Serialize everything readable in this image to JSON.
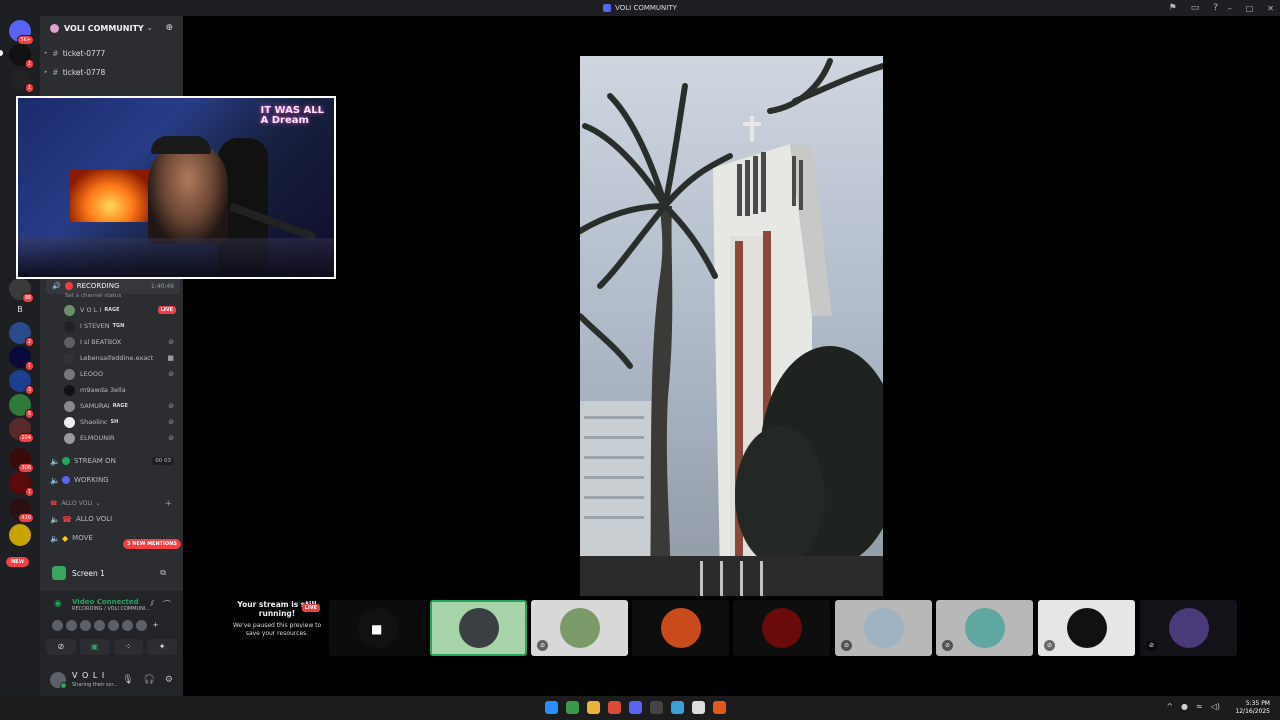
{
  "window": {
    "title": "VOLI COMMUNITY",
    "controls": [
      "–",
      "□",
      "✕"
    ]
  },
  "server": {
    "name": "VOLI COMMUNITY"
  },
  "rail_badges": [
    "5K+",
    "1",
    "1",
    "98",
    "2",
    "1",
    "3",
    "5",
    "6",
    "204",
    "306",
    "1",
    "430",
    "NEW"
  ],
  "rail_letter": "B",
  "channels": [
    {
      "name": "ticket-0777"
    },
    {
      "name": "ticket-0778"
    }
  ],
  "voice_channel": {
    "name": "RECORDING",
    "timer": "1:40:46",
    "status_hint": "Set a channel status"
  },
  "members": [
    {
      "name": "V O L I",
      "tag": "RAGE",
      "live": "LIVE"
    },
    {
      "name": "I STEVEN",
      "tag": "TGN"
    },
    {
      "name": "I sl BEATBOX"
    },
    {
      "name": "Lebensaifeddine.exact"
    },
    {
      "name": "LEOOO"
    },
    {
      "name": "m9awda 3ella"
    },
    {
      "name": "SAMURAI",
      "tag": "RAGE"
    },
    {
      "name": "Shaolinc",
      "tag": "SH"
    },
    {
      "name": "ELMOUNIR"
    }
  ],
  "voice_more": [
    {
      "name": "STREAM ON",
      "count": "00",
      "count2": "03",
      "color": "#23a55a"
    },
    {
      "name": "WORKING",
      "color": "#5865f2"
    }
  ],
  "category": {
    "name": "ALLO VOLI"
  },
  "allo_channels": [
    {
      "name": "ALLO VOLI"
    },
    {
      "name": "MOVE"
    }
  ],
  "mentions": "3 NEW MENTIONS",
  "new_pill": "NEW",
  "screen": {
    "label": "Screen 1"
  },
  "rtc": {
    "status": "Video Connected",
    "location": "RECORDING / VOLI COMMUNI..."
  },
  "user": {
    "name": "V O L I",
    "status": "Sharing their scr..."
  },
  "webcam": {
    "neon_line1": "IT WAS ALL",
    "neon_line2": "A Dream"
  },
  "preview": {
    "title": "Your stream is still running!",
    "body": "We've paused this preview to save your resources.",
    "live": "LIVE"
  },
  "tray": {
    "time": "5:35 PM",
    "date": "12/16/2025"
  }
}
